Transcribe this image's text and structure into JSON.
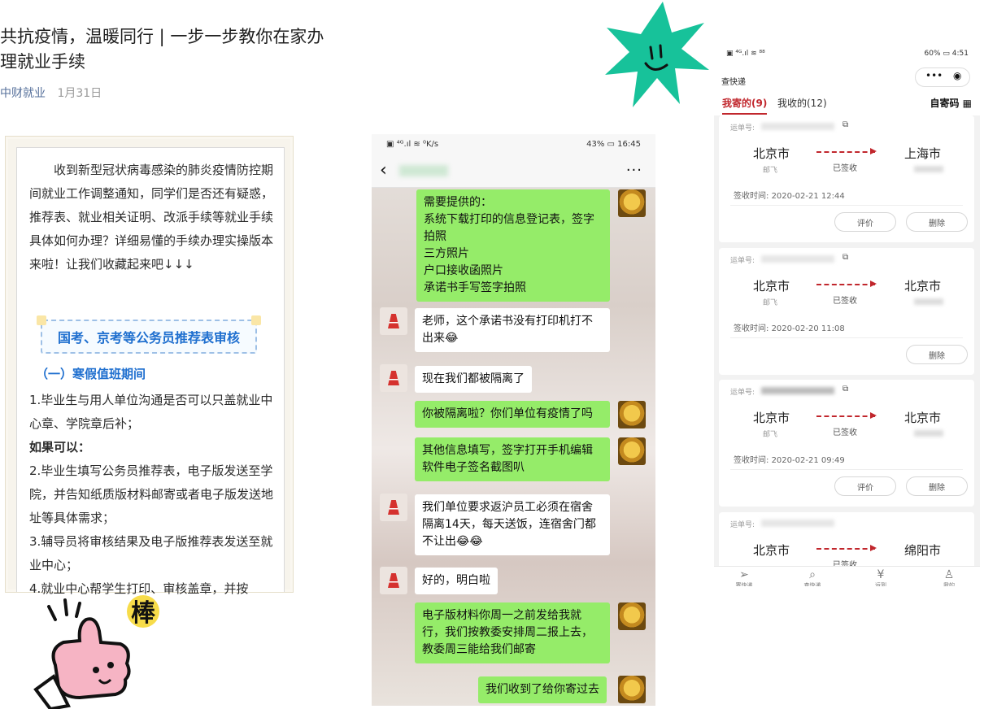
{
  "article": {
    "title": "共抗疫情，温暖同行 | 一步一步教你在家办理就业手续",
    "source": "中财就业",
    "date": "1月31日",
    "intro": "收到新型冠状病毒感染的肺炎疫情防控期间就业工作调整通知，同学们是否还有疑惑，推荐表、就业相关证明、改派手续等就业手续具体如何办理？详细易懂的手续办理实操版本来啦！让我们收藏起来吧↓↓↓",
    "button_label": "国考、京考等公务员推荐表审核",
    "section_heading": "（一）寒假值班期间",
    "items": [
      "1.毕业生与用人单位沟通是否可以只盖就业中心章、学院章后补；",
      "如果可以：",
      "2.毕业生填写公务员推荐表，电子版发送至学院，并告知纸质版材料邮寄或者电子版发送地址等具体需求；",
      "3.辅导员将审核结果及电子版推荐表发送至就业中心；",
      "4.就业中心帮学生打印、审核盖章，并按"
    ]
  },
  "chat": {
    "status_left": "▣ ⁴ᴳ.ıl ≋ ⁰K/s",
    "status_right": "43% ▭ 16:45",
    "back_icon": "‹",
    "more_icon": "···",
    "messages": [
      {
        "side": "me",
        "text": "需要提供的：\n系统下载打印的信息登记表，签字拍照\n三方照片\n户口接收函照片\n承诺书手写签字拍照"
      },
      {
        "side": "them",
        "text": "老师，这个承诺书没有打印机打不出来😂"
      },
      {
        "side": "them",
        "text": "现在我们都被隔离了"
      },
      {
        "side": "me",
        "text": "你被隔离啦？你们单位有疫情了吗"
      },
      {
        "side": "me",
        "text": "其他信息填写，签字打开手机编辑软件电子签名截图叭"
      },
      {
        "side": "them",
        "text": "我们单位要求返沪员工必须在宿舍隔离14天，每天送饭，连宿舍门都不让出😂😂"
      },
      {
        "side": "them",
        "text": "好的，明白啦"
      },
      {
        "side": "me",
        "text": "电子版材料你周一之前发给我就行，我们按教委安排周二报上去，教委周三能给我们邮寄"
      },
      {
        "side": "me",
        "text": "我们收到了给你寄过去"
      }
    ]
  },
  "express": {
    "status_left": "▣ ⁴ᴳ.ıl ≋ ⁸⁸",
    "status_right": "60% ▭ 4:51",
    "app_title": "查快递",
    "capsule_dots": "•••",
    "capsule_target": "◉",
    "tab_sent": "我寄的(9)",
    "tab_received": "我收的(12)",
    "tab_code": "自寄码 ▦",
    "waybill_label": "运单号:",
    "copy_icon": "⧉",
    "time_label": "签收时间:",
    "carrier": "邮飞",
    "status_signed": "已签收",
    "btn_review": "评价",
    "btn_delete": "删除",
    "orders": [
      {
        "from": "北京市",
        "to": "上海市",
        "time": "2020-02-21 12:44",
        "review": true
      },
      {
        "from": "北京市",
        "to": "北京市",
        "time": "2020-02-20 11:08",
        "review": false
      },
      {
        "from": "北京市",
        "to": "北京市",
        "time": "2020-02-21 09:49",
        "review": true
      },
      {
        "from": "北京市",
        "to": "绵阳市",
        "time": "",
        "review": false
      }
    ],
    "tabbar": [
      {
        "icon": "➢",
        "label": "寄快递"
      },
      {
        "icon": "⌕",
        "label": "查快递"
      },
      {
        "icon": "¥",
        "label": "运到"
      },
      {
        "icon": "♙",
        "label": "我的"
      }
    ]
  },
  "stickers": {
    "bang": "棒"
  },
  "colors": {
    "wechat_green": "#95ec69",
    "accent_red": "#c1272d",
    "link_blue": "#1f6fcf",
    "star_green": "#17c29a"
  }
}
